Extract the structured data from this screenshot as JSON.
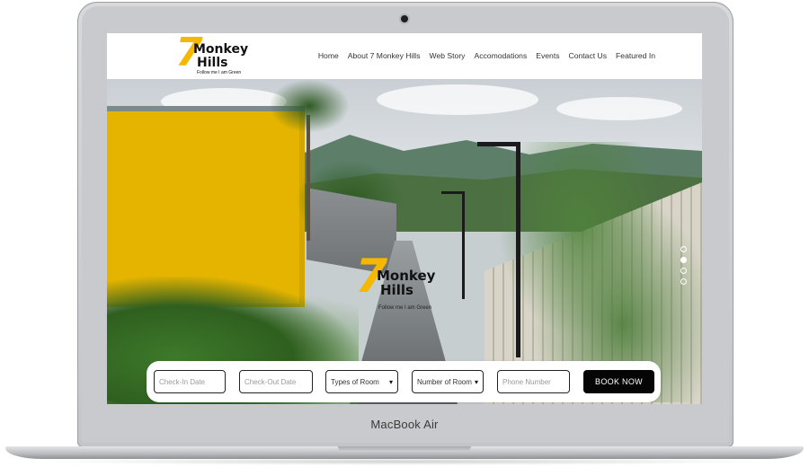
{
  "device": {
    "model_label": "MacBook Air"
  },
  "site": {
    "logo": {
      "number": "7",
      "word1": "Monkey",
      "word2": "Hills",
      "tagline": "Follow me I am Green"
    },
    "nav": [
      {
        "label": "Home"
      },
      {
        "label": "About 7 Monkey Hills"
      },
      {
        "label": "Web Story"
      },
      {
        "label": "Accomodations"
      },
      {
        "label": "Events"
      },
      {
        "label": "Contact Us"
      },
      {
        "label": "Featured In"
      }
    ]
  },
  "hero": {
    "overlay_logo": {
      "number": "7",
      "word1": "Monkey",
      "word2": "Hills",
      "tagline": "Follow me I am Green"
    },
    "slider": {
      "count": 4,
      "active_index": 1
    }
  },
  "booking": {
    "checkin": {
      "placeholder": "Check-In Date"
    },
    "checkout": {
      "placeholder": "Check-Out Date"
    },
    "room_type": {
      "selected": "Types of Room"
    },
    "room_count": {
      "selected": "Number of Room"
    },
    "phone": {
      "placeholder": "Phone Number"
    },
    "submit_label": "BOOK NOW"
  },
  "colors": {
    "brand_yellow": "#f5b800",
    "button_black": "#050505"
  },
  "icons": {
    "select_arrow": "chevron-down-icon",
    "camera": "camera-icon"
  }
}
